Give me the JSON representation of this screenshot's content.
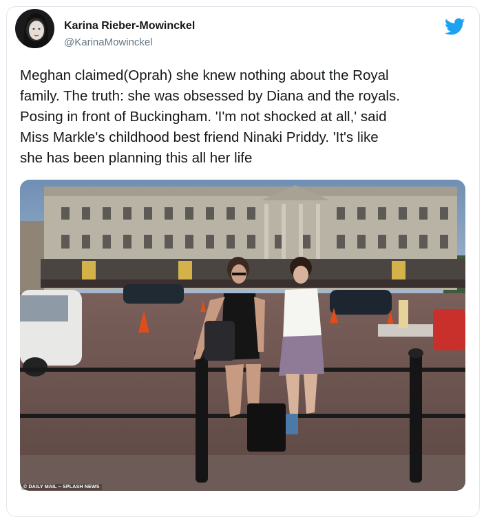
{
  "tweet": {
    "author_name": "Karina Rieber-Mowinckel",
    "author_handle": "@KarinaMowinckel",
    "text_lines": [
      "Meghan claimed(Oprah) she knew nothing about the Royal",
      "family. The truth: she was obsessed by Diana and the royals.",
      "Posing in front of Buckingham. 'I'm not shocked at all,' said",
      "Miss Markle's childhood best friend Ninaki Priddy. 'It's like",
      "she has been planning this all her life"
    ],
    "media_credit": "© DAILY MAIL – SPLASH NEWS"
  },
  "icons": {
    "brand": "twitter-bird-icon",
    "avatar": "profile-photo"
  },
  "colors": {
    "brand_blue": "#1da1f2",
    "text_primary": "#14171a",
    "text_secondary": "#657786",
    "border": "#e1e8ed"
  }
}
